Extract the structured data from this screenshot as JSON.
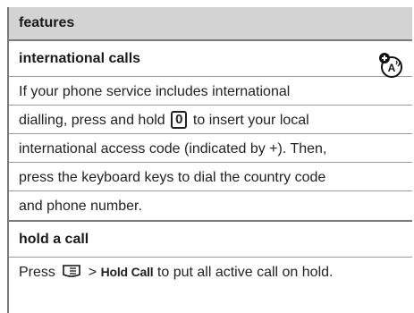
{
  "header": {
    "title": "features"
  },
  "sections": [
    {
      "title": "international calls",
      "icon": "network-feature-icon",
      "lines": [
        "If your phone service includes international",
        {
          "before": "dialling, press and hold ",
          "key": "0",
          "after": " to insert your local"
        },
        "international access code (indicated by +). Then,",
        "press the keyboard keys to dial the country code",
        "and phone number."
      ]
    },
    {
      "title": "hold a call",
      "line": {
        "before": "Press ",
        "menu_key": "menu-key-icon",
        "mid": " > ",
        "command": "Hold Call",
        "after": " to put all active call on hold."
      }
    }
  ]
}
